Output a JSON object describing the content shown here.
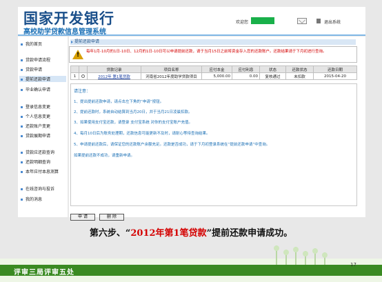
{
  "header": {
    "bank_name": "国家开发银行",
    "system_name": "高校助学贷款信息管理系统",
    "welcome": "欢迎您",
    "logout": "退出系统"
  },
  "sidebar": {
    "items": [
      {
        "label": "我的首页"
      },
      {
        "label": "贷款申请流程"
      },
      {
        "label": "贷款申请"
      },
      {
        "label": "提前还款申请"
      },
      {
        "label": "毕业确认申请"
      },
      {
        "label": "登录信息变更"
      },
      {
        "label": "个人信息变更"
      },
      {
        "label": "还款账户变更"
      },
      {
        "label": "贷款展期申请"
      },
      {
        "label": "贷款应还款查询"
      },
      {
        "label": "还款明细查询"
      },
      {
        "label": "本年应付本息测算"
      },
      {
        "label": "在线咨询与投诉"
      },
      {
        "label": "我的消息"
      }
    ],
    "active_index": 3
  },
  "main": {
    "section_title": "提前还款申请",
    "warning": "每年1月-10月的1日-10日、12月的1日-10日可以申请提前还款，请于当月15日之前将资金存入您的还款账户。还款结果请于下月初进行查询。",
    "table": {
      "headers": [
        "",
        "",
        "贷款记录",
        "项目名称",
        "应付本金",
        "应付利息",
        "状态",
        "还款状态",
        "还款日期"
      ],
      "rows": [
        {
          "no": "1",
          "record": "2012年 第1笔贷款",
          "project": "河南省2012年度助学贷款项目",
          "principal": "5,000.00",
          "interest": "0.00",
          "status": "复核通过",
          "repay_status": "未扣款",
          "date": "2015-04-20"
        }
      ]
    },
    "notice_title": "请注意：",
    "notes": [
      "1、提出提前还款申请，请点击左下角的“申请”按钮。",
      "2、提前还款时，系统自动结算到当月20日，并于当月21日凌晨扣款。",
      "3、如果使用支付宝还款，请登录 支付宝系统 对你的支付宝账户充值。",
      "4、每月10日后为账务处理期，还款信息可能更新不及时，请耐心等待查询结果。",
      "5、申请提前还款后，请保证您的还款账户余额充足。还款是否成功，请于下月初登录系统在“提前还款申请”中查询。",
      "   如果提前还款不成功，请重新申请。"
    ],
    "apply_button": "申 请",
    "delete_button": "删 除"
  },
  "caption": {
    "prefix": "第六步、“",
    "highlight": "2012年第1笔贷款",
    "suffix": "”提前还款申请成功。"
  },
  "footer": {
    "org": "评审三局评审五处",
    "page": "17"
  }
}
